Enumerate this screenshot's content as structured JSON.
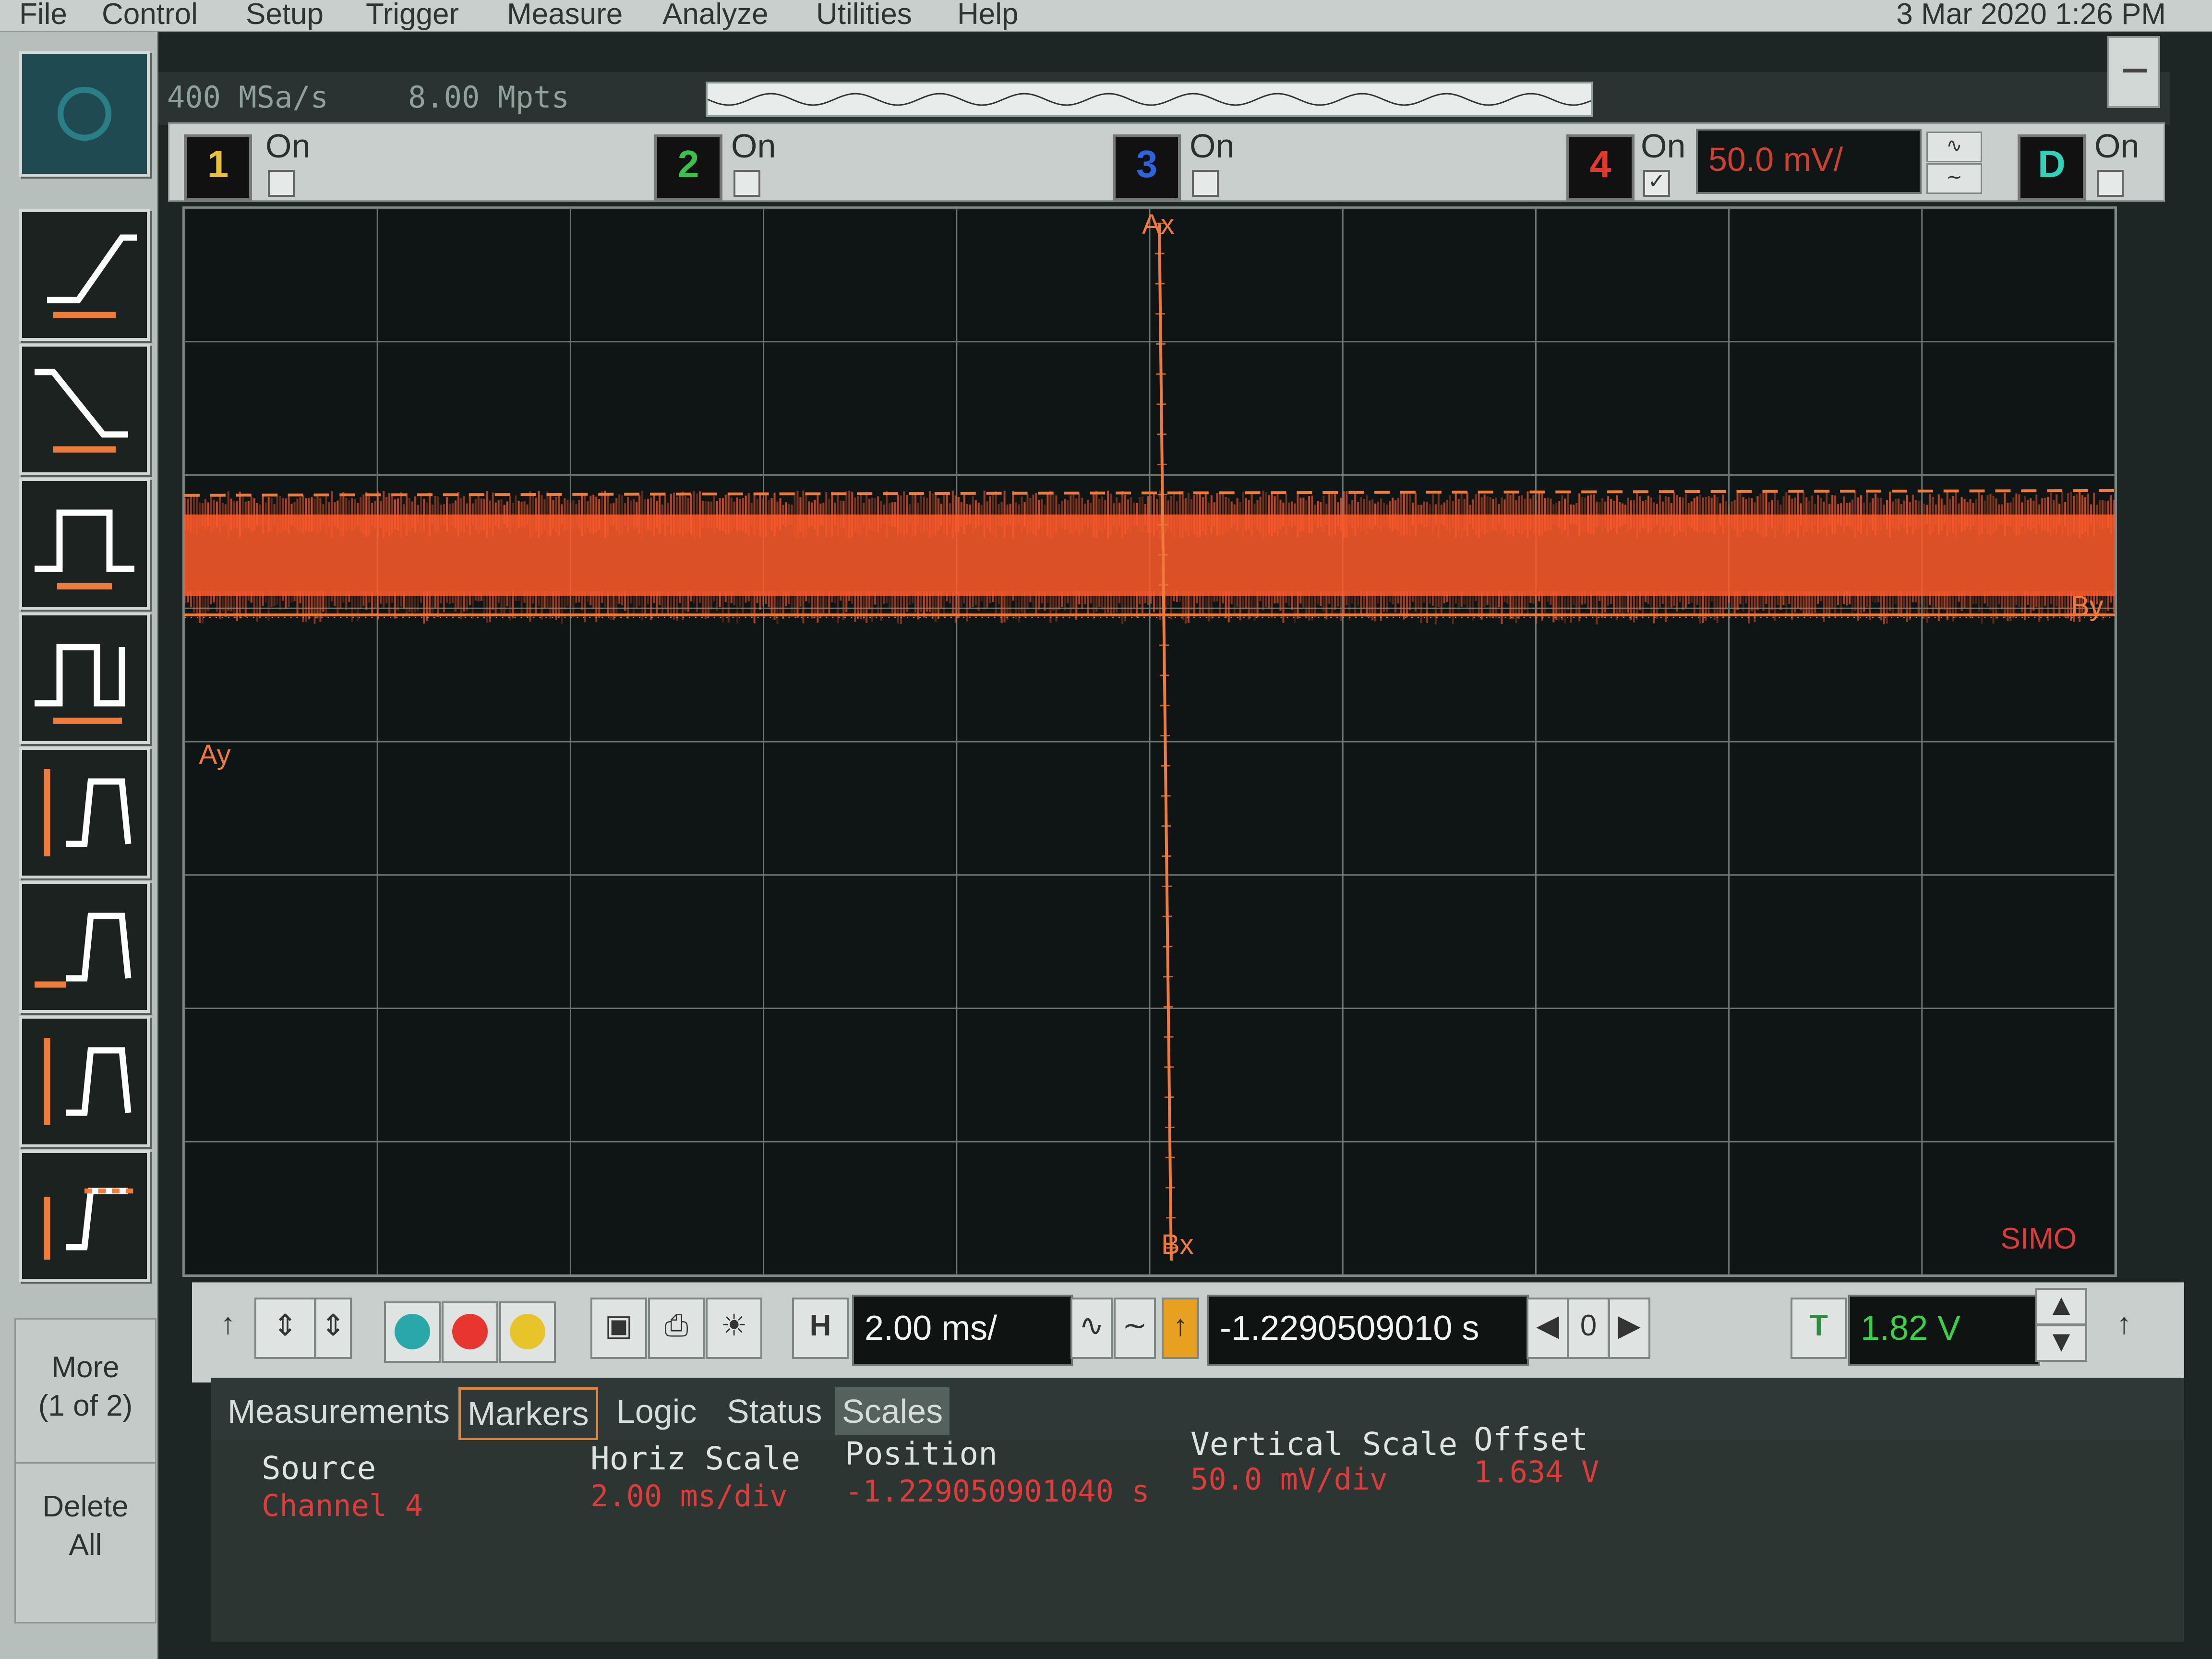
{
  "menubar": {
    "items": [
      "File",
      "Control",
      "Setup",
      "Trigger",
      "Measure",
      "Analyze",
      "Utilities",
      "Help"
    ],
    "datetime": "3 Mar 2020  1:26 PM"
  },
  "acquisition": {
    "sample_rate": "400 MSa/s",
    "memory_depth": "8.00 Mpts"
  },
  "channels": [
    {
      "label": "1",
      "on_label": "On",
      "checked": false,
      "color": "#e8c43a"
    },
    {
      "label": "2",
      "on_label": "On",
      "checked": false,
      "color": "#39c24a"
    },
    {
      "label": "3",
      "on_label": "On",
      "checked": false,
      "color": "#2b63e0"
    },
    {
      "label": "4",
      "on_label": "On",
      "checked": true,
      "color": "#e23a2a"
    },
    {
      "label": "D",
      "on_label": "On",
      "checked": false,
      "color": "#2fd3b8"
    }
  ],
  "channel4_scale": "50.0 mV/",
  "graticule": {
    "marker_ax": "Ax",
    "marker_bx": "Bx",
    "marker_ay": "Ay",
    "marker_by": "By",
    "source_label": "SIMO",
    "trace_color": "#ff5a2a",
    "marker_color": "#f07a3a"
  },
  "controls": {
    "horiz_label": "H",
    "time_per_div": "2.00 ms/",
    "delay": "-1.2290509010 s",
    "delay_ref": "0",
    "trigger_label": "T",
    "trigger_level": "1.82 V"
  },
  "sidebar": {
    "more_line1": "More",
    "more_line2": "(1 of 2)",
    "delete_line1": "Delete",
    "delete_line2": "All"
  },
  "tabs": [
    "Measurements",
    "Markers",
    "Logic",
    "Status",
    "Scales"
  ],
  "scales_panel": {
    "source_head": "Source",
    "source_val": "Channel 4",
    "horiz_head": "Horiz Scale",
    "horiz_val": "2.00 ms/div",
    "position_head": "Position",
    "position_val": "-1.229050901040 s",
    "vert_head": "Vertical Scale",
    "vert_val": "50.0 mV/div",
    "offset_head": "Offset",
    "offset_val": "1.634 V"
  }
}
